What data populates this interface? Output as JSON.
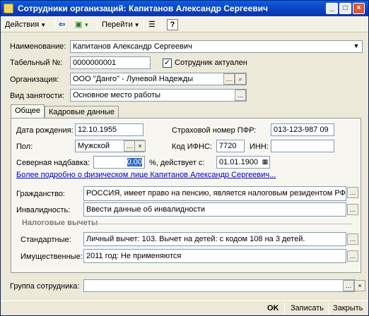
{
  "window": {
    "title": "Сотрудники организаций: Капитанов Александр Сергеевич",
    "minimize": "_",
    "maximize": "□",
    "close": "×"
  },
  "toolbar": {
    "actions": "Действия",
    "goto": "Перейти",
    "help": "?"
  },
  "form": {
    "name_label": "Наименование:",
    "name_value": "Капитанов Александр Сергеевич",
    "tabno_label": "Табельный №:",
    "tabno_value": "0000000001",
    "active_label": "Сотрудник актуален",
    "active_checked": "✓",
    "org_label": "Организация:",
    "org_value": "ООО \"Данго\" - Луневой Надежды",
    "employment_label": "Вид занятости:",
    "employment_value": "Основное место работы"
  },
  "tabs": [
    "Общее",
    "Кадровые данные"
  ],
  "general": {
    "birth_label": "Дата рождения:",
    "birth_value": "12.10.1955",
    "pfr_label": "Страховой номер ПФР:",
    "pfr_value": "013-123-987 09",
    "gender_label": "Пол:",
    "gender_value": "Мужской",
    "ifns_label": "Код ИФНС:",
    "ifns_value": "7720",
    "inn_label": "ИНН:",
    "inn_value": "",
    "north_label": "Северная надбавка:",
    "north_value": "0.00",
    "north_suffix": "%, действует с:",
    "north_date": "01.01.1900",
    "details_link": "Более подробно о физическом лице Капитанов Александр Сергеевич...",
    "citizenship_label": "Гражданство:",
    "citizenship_value": "РОССИЯ, имеет право на пенсию, является налоговым резидентом РФ",
    "disability_label": "Инвалидность:",
    "disability_value": "Ввести данные об инвалидности",
    "tax_header": "Налоговые вычеты",
    "standard_label": "Стандартные:",
    "standard_value": "Личный вычет: 103. Вычет на детей: с кодом 108 на 3 детей.",
    "property_label": "Имущественные:",
    "property_value": "2011 год: Не применяются"
  },
  "group_label": "Группа сотрудника:",
  "group_value": "",
  "footer": {
    "ok": "OK",
    "save": "Записать",
    "close": "Закрыть"
  }
}
